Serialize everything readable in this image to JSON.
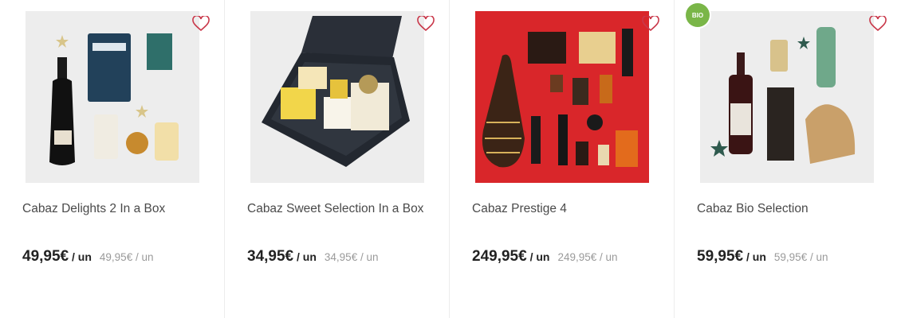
{
  "products": [
    {
      "name": "Cabaz Delights 2 In a Box",
      "price": "49,95€",
      "unit": " / un",
      "old_price": "49,95€ / un",
      "favorite_icon": "heart-outline-icon"
    },
    {
      "name": "Cabaz Sweet Selection In a Box",
      "price": "34,95€",
      "unit": " / un",
      "old_price": "34,95€ / un",
      "favorite_icon": "heart-outline-icon"
    },
    {
      "name": "Cabaz Prestige 4",
      "price": "249,95€",
      "unit": " / un",
      "old_price": "249,95€ / un",
      "favorite_icon": "heart-outline-icon"
    },
    {
      "name": "Cabaz Bio Selection",
      "price": "59,95€",
      "unit": " / un",
      "old_price": "59,95€ / un",
      "favorite_icon": "heart-outline-icon",
      "badge_icon": "organic-leaf-badge-icon"
    }
  ],
  "colors": {
    "accent": "#c9384a",
    "badge": "#7ab648",
    "price": "#222222",
    "old_price": "#9a9a9a"
  }
}
